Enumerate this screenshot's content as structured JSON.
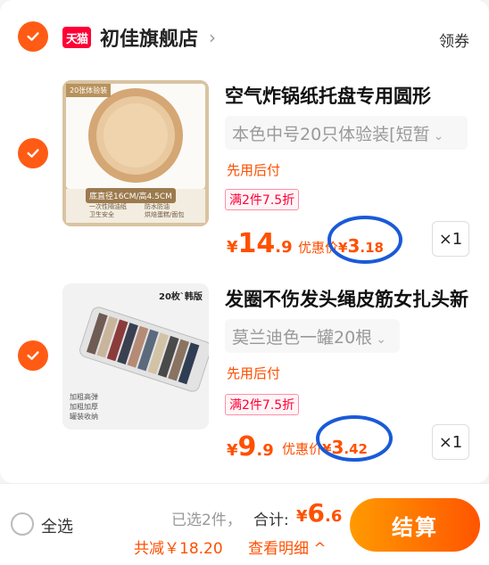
{
  "store": {
    "badge": "天猫",
    "name": "初佳旗舰店",
    "arrow": "›",
    "coupon": "领券"
  },
  "items": [
    {
      "title": "空气炸锅纸托盘专用圆形",
      "sku": "本色中号20只体验装[短暂",
      "sku_chevron": "⌄",
      "pay_tag": "先用后付",
      "discount_tag": "满2件7.5折",
      "price_symbol": "¥",
      "price_int": "14",
      "price_dec": ".9",
      "promo_label": "优惠价",
      "promo_symbol": "¥",
      "promo_int": "3",
      "promo_dec": ".18",
      "qty": "×1",
      "thumb": {
        "corner_label": "20张体验装",
        "size_label": "底直径16CM/高4.5CM",
        "features": [
          "一次性隔油纸",
          "防水防油",
          "卫生安全",
          "烘焙蛋糕/面包"
        ]
      }
    },
    {
      "title": "发圈不伤发头绳皮筋女扎头新",
      "sku": "莫兰迪色一罐20根",
      "sku_chevron": "⌄",
      "pay_tag": "先用后付",
      "discount_tag": "满2件7.5折",
      "price_symbol": "¥",
      "price_int": "9",
      "price_dec": ".9",
      "promo_label": "优惠价",
      "promo_symbol": "¥",
      "promo_int": "3",
      "promo_dec": ".42",
      "qty": "×1",
      "thumb": {
        "title": "20枚`韩版",
        "features": [
          "加粗高弹",
          "加粗加厚",
          "罐装收纳"
        ]
      }
    }
  ],
  "footer": {
    "select_all": "全选",
    "selected_count": "已选2件，",
    "total_label": "合计:",
    "total_symbol": "¥",
    "total_int": "6",
    "total_dec": ".6",
    "saving": "共减￥18.20",
    "details": "查看明细 ^",
    "checkout": "结算"
  },
  "colors": {
    "accent": "#ff5000",
    "check": "#ff5b14",
    "tmall": "#ff0036",
    "annotation": "#1a5ad8"
  }
}
